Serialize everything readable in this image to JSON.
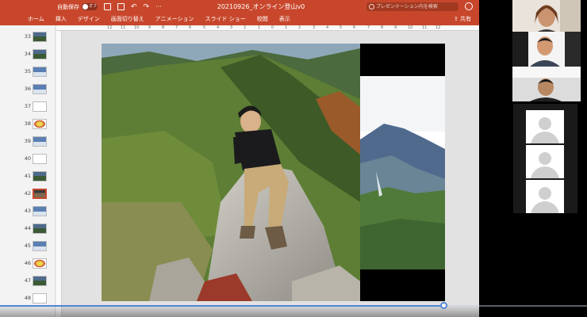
{
  "powerpoint": {
    "autosave_label": "自動保存",
    "autosave_state": "オフ",
    "document_title": "20210926_オンライン登山v0",
    "search_placeholder": "プレゼンテーション内を検索",
    "share_label": "共有",
    "ribbon_tabs": [
      "ホーム",
      "挿入",
      "デザイン",
      "画面切り替え",
      "アニメーション",
      "スライド ショー",
      "校閲",
      "表示"
    ],
    "accent_color": "#c8472c",
    "ruler_top": [
      "12",
      "11",
      "10",
      "9",
      "8",
      "7",
      "6",
      "5",
      "4",
      "3",
      "2",
      "1",
      "0",
      "1",
      "2",
      "3",
      "4",
      "5",
      "6",
      "7",
      "8",
      "9",
      "10",
      "11",
      "12"
    ],
    "slide_thumbnails": [
      {
        "number": "33"
      },
      {
        "number": "34"
      },
      {
        "number": "35"
      },
      {
        "number": "36"
      },
      {
        "number": "37"
      },
      {
        "number": "38"
      },
      {
        "number": "39"
      },
      {
        "number": "40"
      },
      {
        "number": "41"
      },
      {
        "number": "42"
      },
      {
        "number": "43"
      },
      {
        "number": "44"
      },
      {
        "number": "45"
      },
      {
        "number": "46"
      },
      {
        "number": "47"
      },
      {
        "number": "48"
      }
    ],
    "active_slide": "42"
  },
  "video_player": {
    "progress_fraction": 0.755,
    "progress_color": "#4f86d6"
  },
  "icons": {
    "autosave": "toggle-icon",
    "save": "save-icon",
    "undo": "undo-icon",
    "redo": "redo-icon",
    "search": "search-icon",
    "feedback": "smiley-icon",
    "share": "share-icon",
    "participant_placeholder": "person-silhouette-icon"
  }
}
